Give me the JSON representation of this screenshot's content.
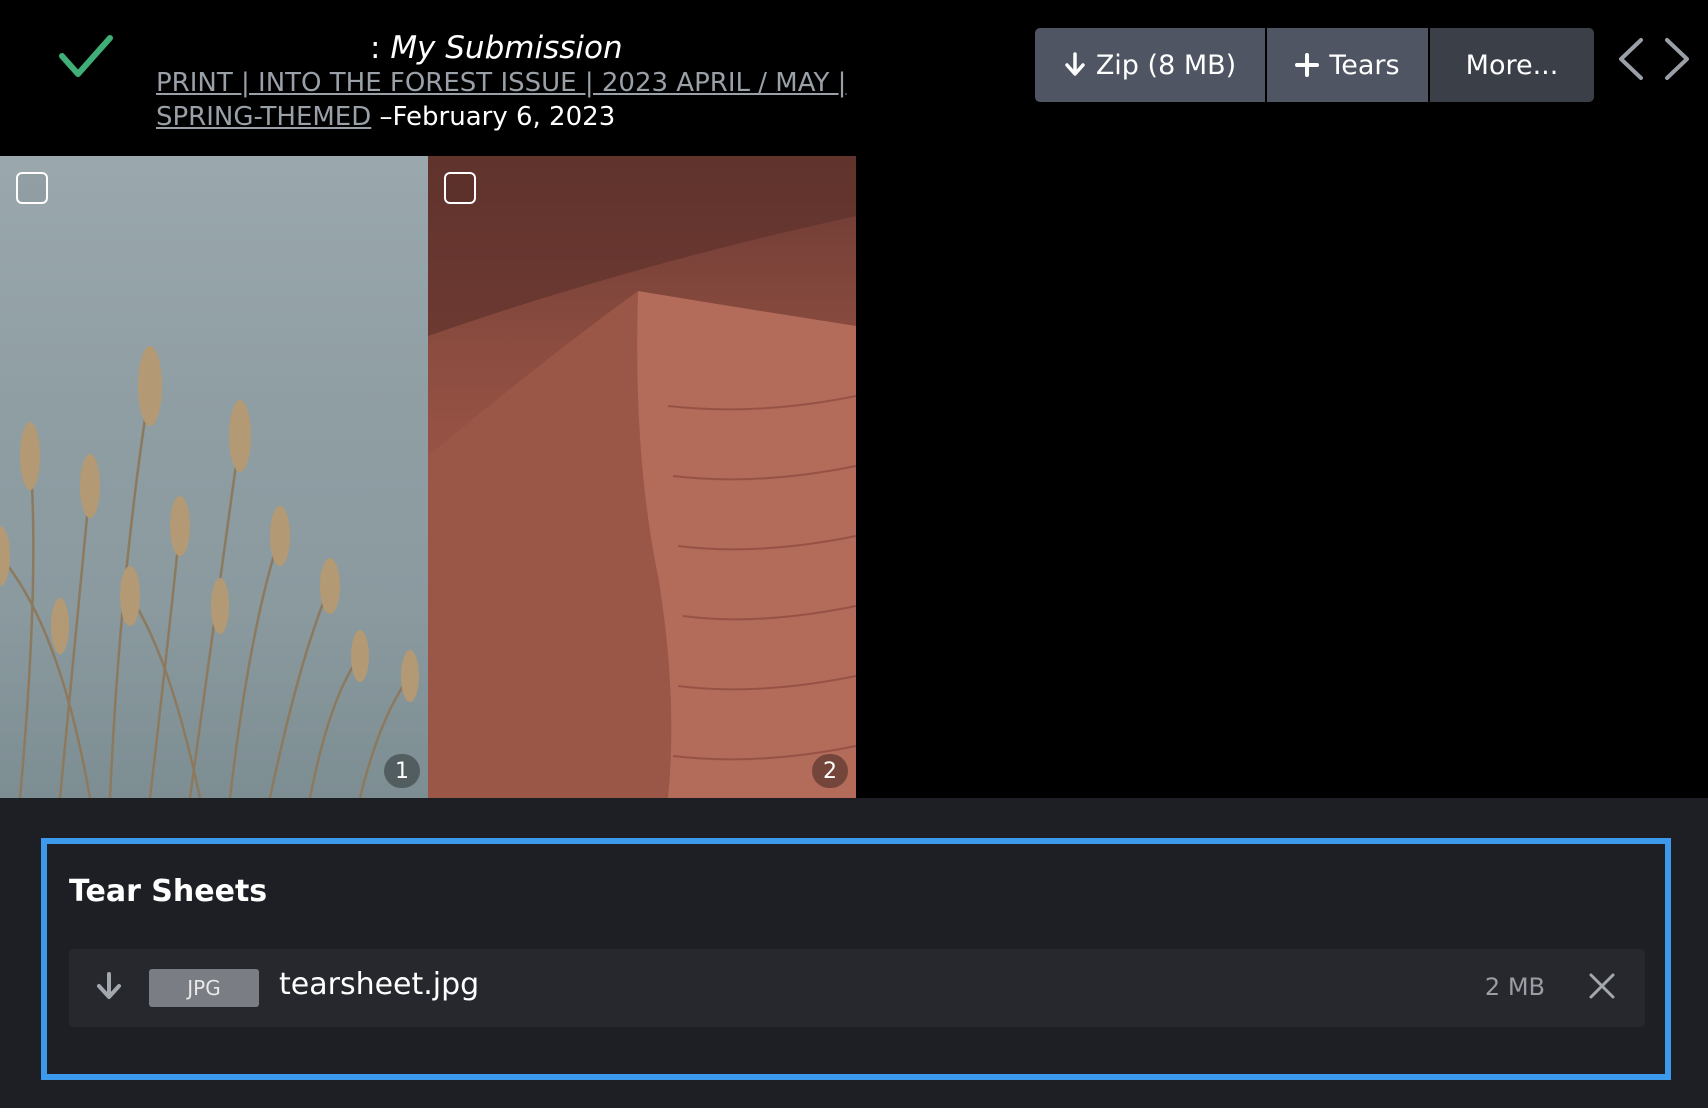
{
  "header": {
    "title_prefix": ":",
    "title": "My Submission",
    "link_text_line1": "PRINT | INTO THE FOREST ISSUE | 2023 APRIL / MAY |",
    "link_text_line2": "SPRING-THEMED",
    "date_text": "–February 6, 2023"
  },
  "toolbar": {
    "zip_label": "Zip (8 MB)",
    "tears_label": "Tears",
    "more_label": "More..."
  },
  "gallery": {
    "images": [
      {
        "number": "1",
        "description_icon": "reeds-photo"
      },
      {
        "number": "2",
        "description_icon": "dune-photo"
      }
    ]
  },
  "tear_sheets": {
    "heading": "Tear Sheets",
    "files": [
      {
        "type": "JPG",
        "name": "tearsheet.jpg",
        "size": "2 MB"
      }
    ]
  },
  "colors": {
    "accent": "#3c99ec",
    "check": "#3fae77",
    "button_bg": "#4f5562"
  }
}
